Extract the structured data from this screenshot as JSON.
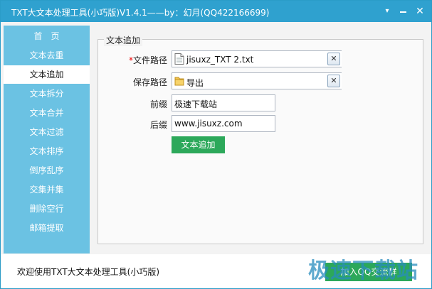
{
  "window": {
    "title": "TXT大文本处理工具(小巧版)V1.4.1——by：幻月(QQ422166699)",
    "menu_icon": "chevron-down-icon",
    "minimize_icon": "minimize-icon",
    "close_icon": "close-icon",
    "close_glyph": "✕",
    "menu_glyph": "▾"
  },
  "sidebar": {
    "items": [
      {
        "label": "首　页",
        "active": false
      },
      {
        "label": "文本去重",
        "active": false
      },
      {
        "label": "文本追加",
        "active": true
      },
      {
        "label": "文本拆分",
        "active": false
      },
      {
        "label": "文本合并",
        "active": false
      },
      {
        "label": "文本过滤",
        "active": false
      },
      {
        "label": "文本排序",
        "active": false
      },
      {
        "label": "倒序乱序",
        "active": false
      },
      {
        "label": "交集并集",
        "active": false
      },
      {
        "label": "删除空行",
        "active": false
      },
      {
        "label": "邮箱提取",
        "active": false
      }
    ]
  },
  "panel": {
    "group_title": "文本追加",
    "file_path": {
      "required_mark": "*",
      "label": "文件路径",
      "value": "jisuxz_TXT 2.txt",
      "icon": "text-file-icon",
      "clear": "✕"
    },
    "save_path": {
      "label": "保存路径",
      "value": "导出",
      "icon": "folder-icon",
      "clear": "✕"
    },
    "prefix": {
      "label": "前缀",
      "value": "极速下载站"
    },
    "suffix": {
      "label": "后缀",
      "value": "www.jisuxz.com"
    },
    "action_button": "文本追加"
  },
  "statusbar": {
    "text": "欢迎使用TXT大文本处理工具(小巧版)",
    "join_button": "加入QQ交流群",
    "watermark": "极速下载站"
  },
  "colors": {
    "titlebar": "#2fa1cf",
    "sidebar": "#6bc2e3",
    "accent_green": "#2ca85a"
  }
}
